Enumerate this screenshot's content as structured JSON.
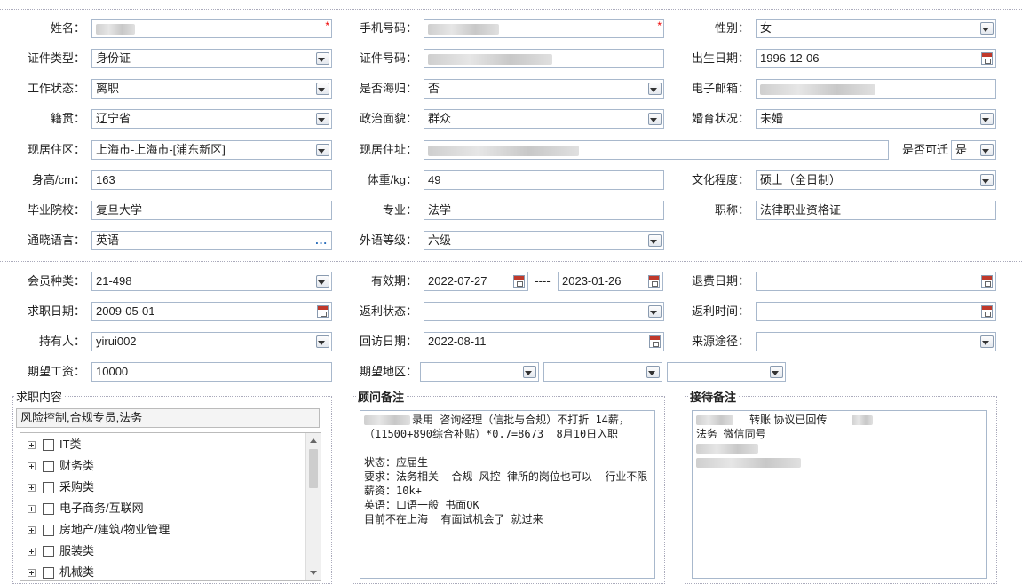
{
  "labels": {
    "name": "姓名：",
    "phone": "手机号码：",
    "gender": "性别：",
    "id_type": "证件类型：",
    "id_no": "证件号码：",
    "birth": "出生日期：",
    "work_status": "工作状态：",
    "overseas": "是否海归：",
    "email": "电子邮箱：",
    "origin": "籍贯：",
    "political": "政治面貌：",
    "marital": "婚育状况：",
    "residence_area": "现居住区：",
    "residence_addr": "现居住址：",
    "relocate": "是否可迁",
    "height": "身高/cm：",
    "weight": "体重/kg：",
    "education": "文化程度：",
    "school": "毕业院校：",
    "major": "专业：",
    "title": "职称：",
    "language": "通晓语言：",
    "lang_level": "外语等级：",
    "member_type": "会员种类：",
    "validity": "有效期：",
    "refund_date": "退费日期：",
    "job_date": "求职日期：",
    "rebate_status": "返利状态：",
    "rebate_time": "返利时间：",
    "holder": "持有人：",
    "visit_date": "回访日期：",
    "source": "来源途径：",
    "salary": "期望工资：",
    "region": "期望地区：",
    "validity_sep": "----"
  },
  "values": {
    "gender": "女",
    "id_type": "身份证",
    "birth": "1996-12-06",
    "work_status": "离职",
    "overseas": "否",
    "origin": "辽宁省",
    "political": "群众",
    "marital": "未婚",
    "residence_area": "上海市-上海市-[浦东新区]",
    "relocate": "是",
    "height": "163",
    "weight": "49",
    "education": "硕士（全日制）",
    "school": "复旦大学",
    "major": "法学",
    "title": "法律职业资格证",
    "language": "英语",
    "lang_level": "六级",
    "member_type": "21-498",
    "valid_from": "2022-07-27",
    "valid_to": "2023-01-26",
    "refund_date": "",
    "job_date": "2009-05-01",
    "rebate_status": "",
    "rebate_time": "",
    "holder": "yirui002",
    "visit_date": "2022-08-11",
    "source": "",
    "salary": "10000",
    "region1": "",
    "region2": "",
    "region3": "",
    "language_button": "..."
  },
  "panels": {
    "job_content_title": "求职内容",
    "job_content_value": "风险控制,合规专员,法务",
    "advisor_title": "顾问备注",
    "advisor_note": "录用 咨询经理（信批与合规）不打折 14薪，\n（11500+890综合补贴）*0.7=8673  8月10日入职\n\n状态：应届生\n要求：法务相关  合规 风控 律所的岗位也可以  行业不限\n薪资：10k+\n英语：口语一般 书面OK\n目前不在上海  有面试机会了 就过来",
    "reception_title": "接待备注",
    "reception_line1": "转账 协议已回传",
    "reception_line2": "法务  微信同号"
  },
  "tree": [
    "IT类",
    "财务类",
    "采购类",
    "电子商务/互联网",
    "房地产/建筑/物业管理",
    "服装类",
    "机械类"
  ],
  "colors": {
    "border": "#a8b8cc",
    "required": "#ee0000",
    "separator": "#aabbcc"
  }
}
